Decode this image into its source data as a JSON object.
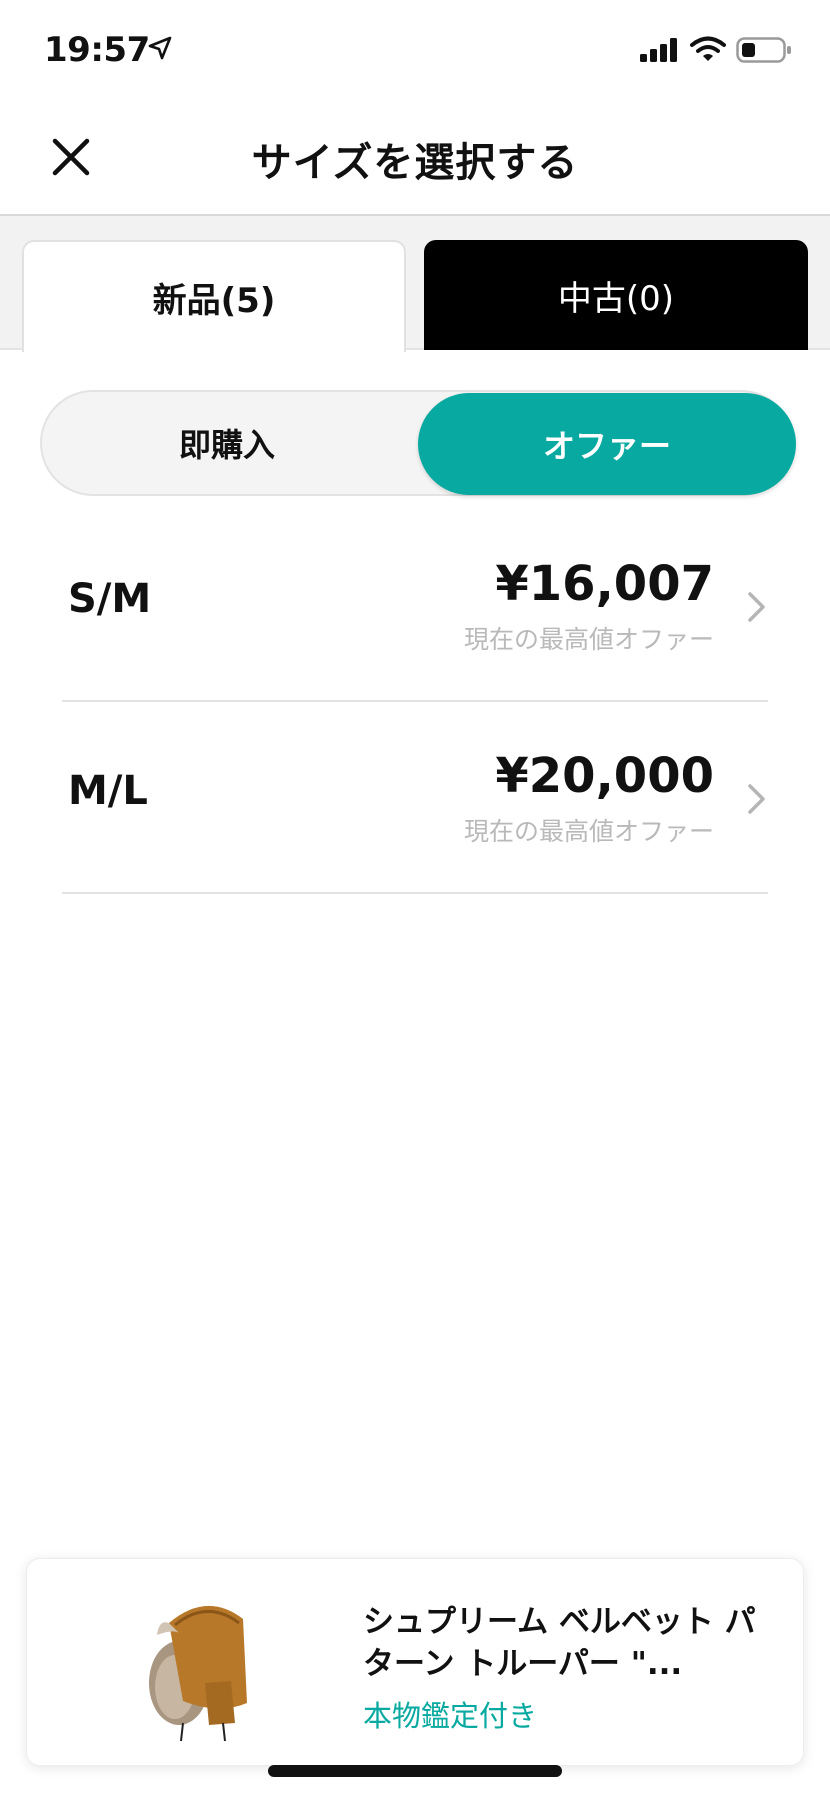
{
  "status": {
    "time": "19:57"
  },
  "header": {
    "title": "サイズを選択する"
  },
  "tabs": [
    {
      "label": "新品(5)",
      "selected": true
    },
    {
      "label": "中古(0)",
      "selected": false
    }
  ],
  "segment": {
    "options": [
      "即購入",
      "オファー"
    ],
    "selected": "オファー"
  },
  "sizes": [
    {
      "size": "S/M",
      "price": "¥16,007",
      "note": "現在の最高値オファー"
    },
    {
      "size": "M/L",
      "price": "¥20,000",
      "note": "現在の最高値オファー"
    }
  ],
  "product": {
    "name": "シュプリーム ベルベット パターン トルーパー \"...",
    "badge": "本物鑑定付き"
  },
  "colors": {
    "accent": "#08a9a0",
    "tab_dark": "#000000",
    "muted": "#b9b9b9"
  }
}
